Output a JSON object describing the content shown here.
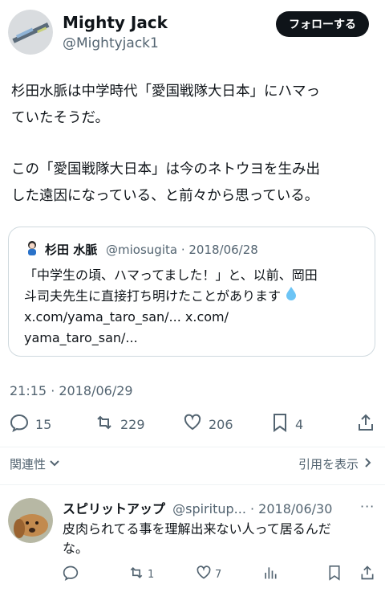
{
  "tweet": {
    "author_name": "Mighty Jack",
    "author_handle": "@Mightyjack1",
    "follow_label": "フォローする",
    "text_line1": "杉田水脈は中学時代「愛国戦隊大日本」にハマっ",
    "text_line2": "ていたそうだ。",
    "text_line3": "この「愛国戦隊大日本」は今のネトウヨを生み出",
    "text_line4": "した遠因になっている、と前々から思っている。",
    "quote": {
      "name": "杉田 水脈",
      "handle_date": "@miosugita · 2018/06/28",
      "line1": "「中学生の頃、ハマってました！」と、以前、岡田",
      "line2": "斗司夫先生に直接打ち明けたことがあります",
      "line3": "x.com/yama_taro_san/... x.com/",
      "line4": "yama_taro_san/..."
    },
    "timestamp": "21:15 · 2018/06/29",
    "stats": {
      "replies": "15",
      "retweets": "229",
      "likes": "206",
      "bookmarks": "4"
    },
    "related_label": "関連性",
    "quote_link_label": "引用を表示"
  },
  "reply": {
    "name": "スピリットアップ",
    "handle_date": "@spiritup... · 2018/06/30",
    "line1": "皮肉られてる事を理解出来ない人って居るんだ",
    "line2": "な。",
    "stats": {
      "retweets": "1",
      "likes": "7"
    }
  },
  "colors": {
    "text": "#0f1419",
    "secondary": "#536471",
    "border": "#cfd9de",
    "blue": "#1d9bf0"
  }
}
